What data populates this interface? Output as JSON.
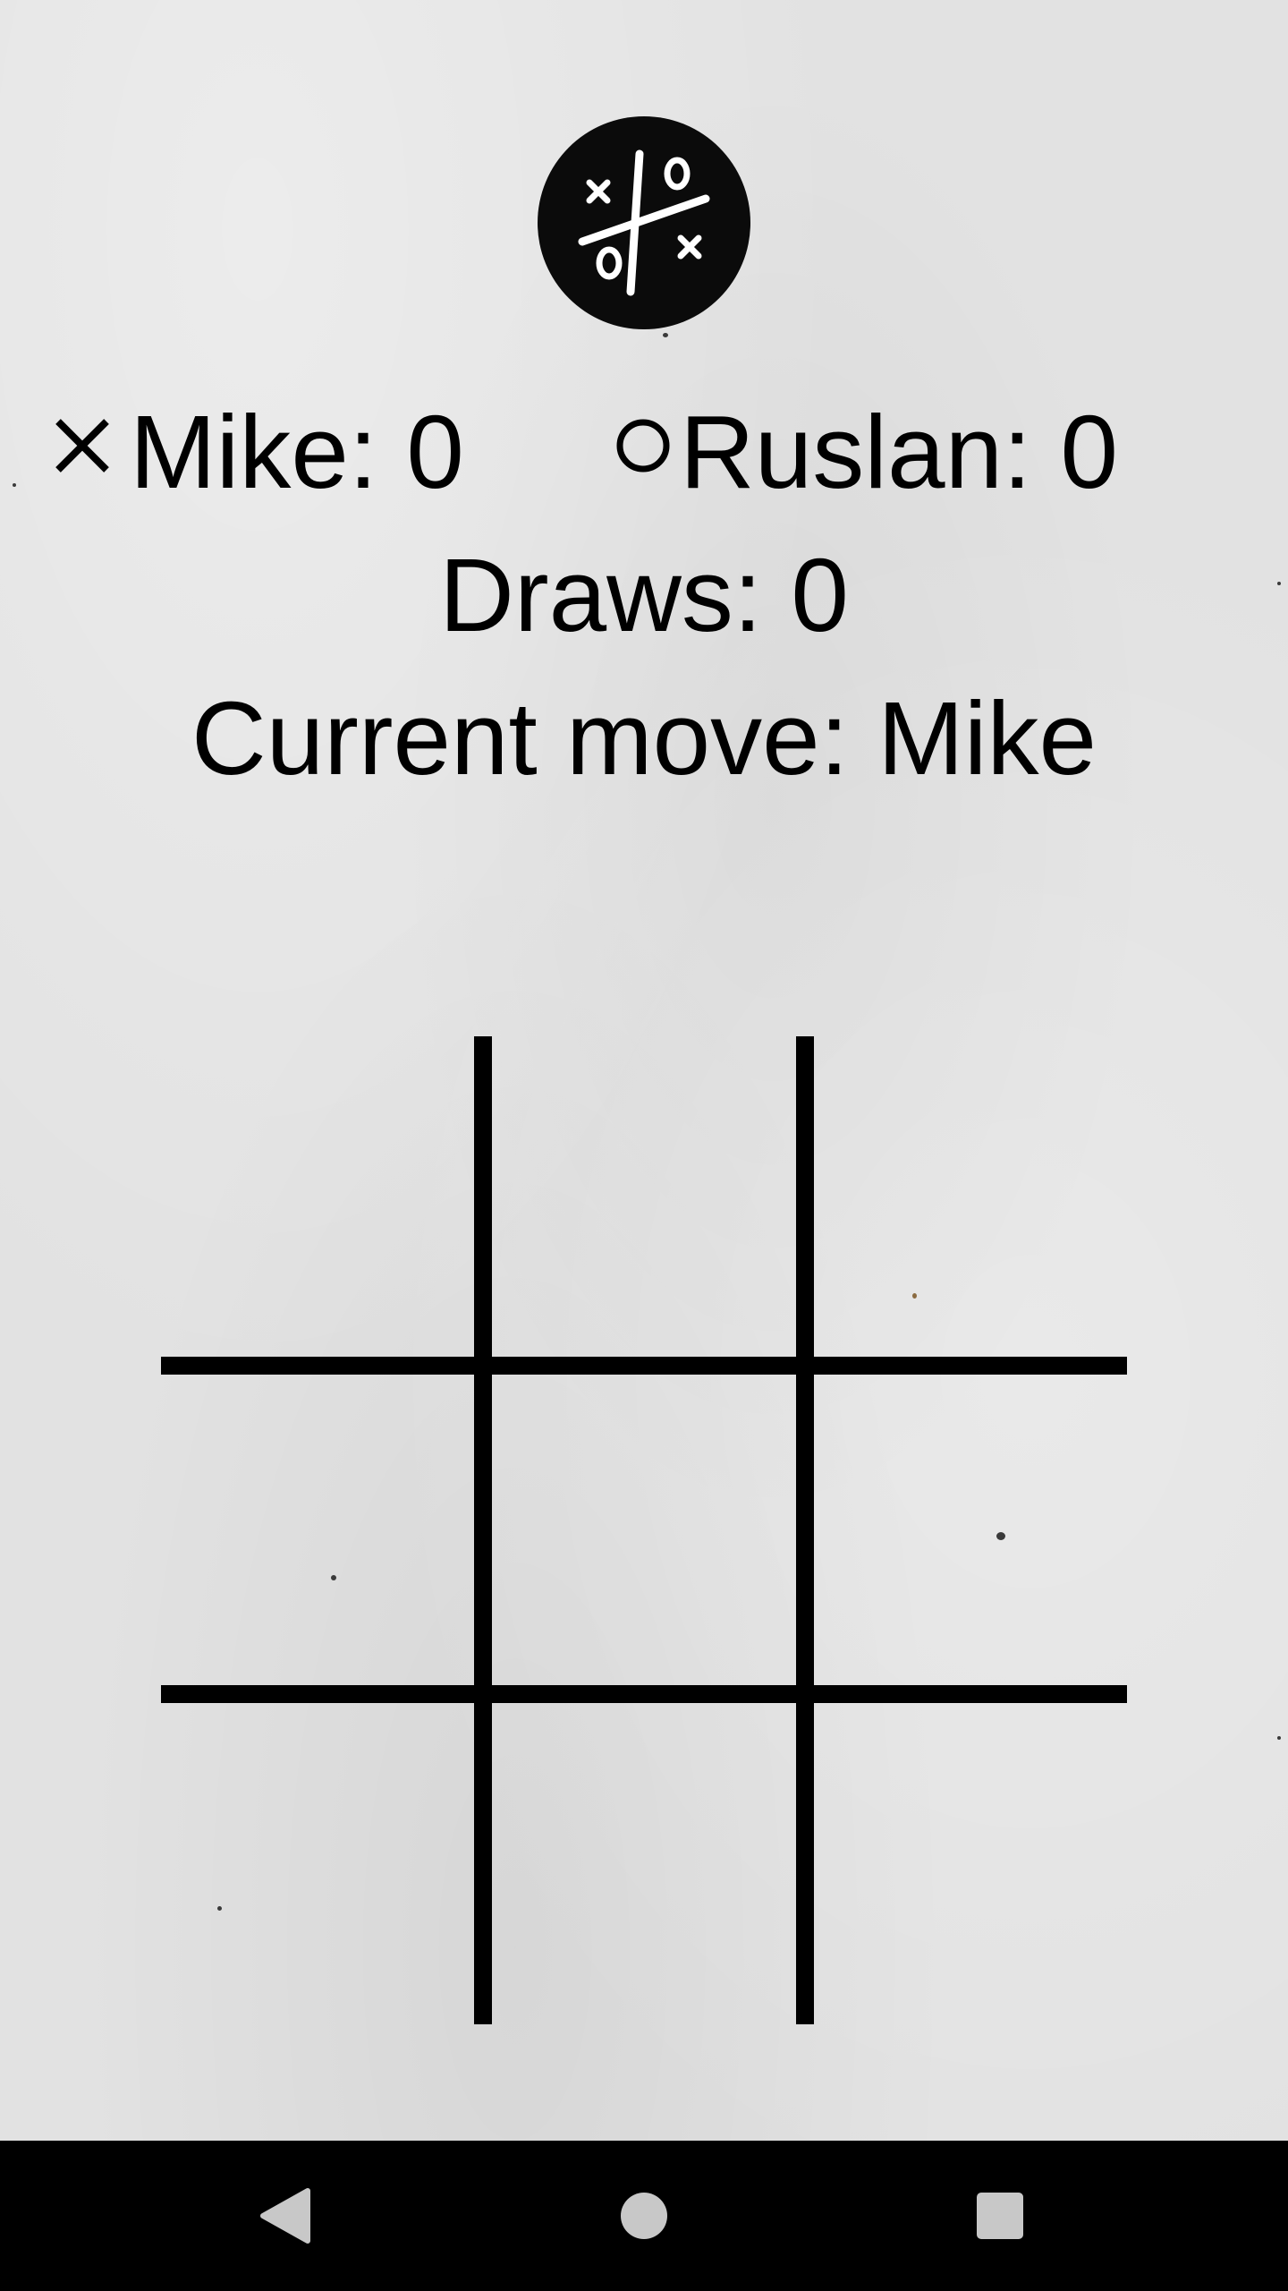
{
  "app": {
    "logo_icon": "tic-tac-toe-logo-icon"
  },
  "scores": {
    "player1": {
      "symbol_icon": "cross-icon",
      "label": "Mike: 0"
    },
    "player2": {
      "symbol_icon": "circle-icon",
      "label": "Ruslan: 0"
    },
    "draws_label": "Draws: 0"
  },
  "status": {
    "current_move_label": "Current move: Mike"
  },
  "board": {
    "cells": [
      "",
      "",
      "",
      "",
      "",
      "",
      "",
      "",
      ""
    ]
  },
  "nav": {
    "back_icon": "back-triangle-icon",
    "home_icon": "home-circle-icon",
    "recent_icon": "recent-square-icon"
  },
  "colors": {
    "paper": "#e2e2e2",
    "ink": "#000000",
    "nav_icon": "#c8c8c8"
  }
}
